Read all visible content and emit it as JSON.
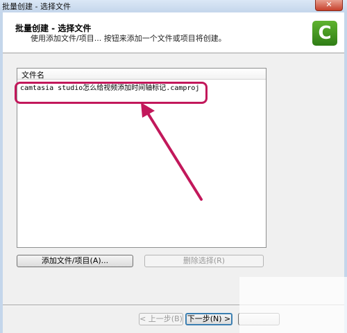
{
  "window": {
    "title": "批量创建 - 选择文件",
    "close_glyph": "✕"
  },
  "header": {
    "title": "批量创建 - 选择文件",
    "description": "使用添加文件/项目... 按钮来添加一个文件或项目将创建。",
    "logo_letter": "C",
    "logo_color": "#3f9420"
  },
  "file_list": {
    "column_header": "文件名",
    "rows": [
      "camtasia studio怎么给视频添加时间轴标记.camproj"
    ]
  },
  "buttons": {
    "add_file": "添加文件/项目(A)...",
    "remove_selection": "删除选择(R)",
    "back": "< 上一步(B)",
    "next": "下一步(N) >",
    "cancel": ""
  },
  "annotation": {
    "color": "#c2185b"
  }
}
